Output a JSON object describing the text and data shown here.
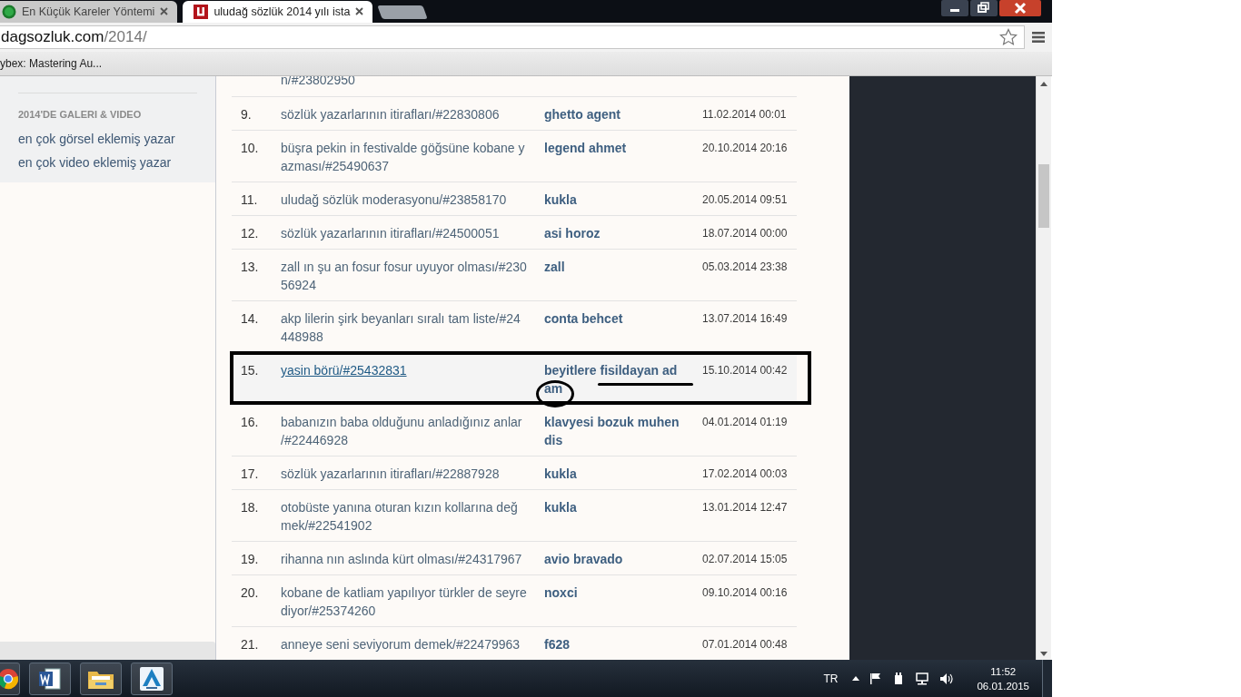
{
  "browser": {
    "tabs": [
      {
        "title": "En Küçük Kareler Yöntemi",
        "selected": false
      },
      {
        "title": "uludağ sözlük 2014 yılı ista",
        "selected": true
      }
    ],
    "address": {
      "host": "dagsozluk.com",
      "path": "/2014/"
    },
    "bookmarks": [
      "ybex: Mastering Au..."
    ]
  },
  "sidebar": {
    "heading": "2014'DE GALERI & VIDEO",
    "links": [
      "en çok görsel eklemiş yazar",
      "en çok video eklemiş yazar"
    ]
  },
  "table": {
    "rows": [
      {
        "kind": "partial",
        "title": "n/#23802950"
      },
      {
        "kind": "entry",
        "number": "9.",
        "title": "sözlük yazarlarının itirafları/#22830806",
        "author": "ghetto agent",
        "date": "11.02.2014 00:01",
        "selected": false
      },
      {
        "kind": "entry",
        "number": "10.",
        "title": "büşra pekin in festivalde göğsüne kobane yazması/#25490637",
        "author": "legend ahmet",
        "date": "20.10.2014 20:16",
        "selected": false
      },
      {
        "kind": "entry",
        "number": "11.",
        "title": "uludağ sözlük moderasyonu/#23858170",
        "author": "kukla",
        "date": "20.05.2014 09:51",
        "selected": false
      },
      {
        "kind": "entry",
        "number": "12.",
        "title": "sözlük yazarlarının itirafları/#24500051",
        "author": "asi horoz",
        "date": "18.07.2014 00:00",
        "selected": false
      },
      {
        "kind": "entry",
        "number": "13.",
        "title": "zall ın şu an fosur fosur uyuyor olması/#23056924",
        "author": "zall",
        "date": "05.03.2014 23:38",
        "selected": false
      },
      {
        "kind": "entry",
        "number": "14.",
        "title": "akp lilerin şirk beyanları sıralı tam liste/#24448988",
        "author": "conta behcet",
        "date": "13.07.2014 16:49",
        "selected": false
      },
      {
        "kind": "entry",
        "number": "15.",
        "title": "yasin börü/#25432831",
        "author": "beyitlere fisildayan adam",
        "date": "15.10.2014 00:42",
        "selected": true,
        "annotations": [
          {
            "kind": "frame"
          },
          {
            "kind": "circle"
          },
          {
            "kind": "underline"
          }
        ]
      },
      {
        "kind": "entry",
        "number": "16.",
        "title": "babanızın baba olduğunu anladığınız anlar /#22446928",
        "author": "klavyesi bozuk muhendis",
        "date": "04.01.2014 01:19",
        "selected": false
      },
      {
        "kind": "entry",
        "number": "17.",
        "title": "sözlük yazarlarının itirafları/#22887928",
        "author": "kukla",
        "date": "17.02.2014 00:03",
        "selected": false
      },
      {
        "kind": "entry",
        "number": "18.",
        "title": "otobüste yanına oturan kızın kollarına değmek/#22541902",
        "author": "kukla",
        "date": "13.01.2014 12:47",
        "selected": false
      },
      {
        "kind": "entry",
        "number": "19.",
        "title": "rihanna nın aslında kürt olması/#24317967",
        "author": "avio bravado",
        "date": "02.07.2014 15:05",
        "selected": false
      },
      {
        "kind": "entry",
        "number": "20.",
        "title": "kobane de katliam yapılıyor türkler de seyrediyor/#25374260",
        "author": "noxci",
        "date": "09.10.2014 00:16",
        "selected": false
      },
      {
        "kind": "entry",
        "number": "21.",
        "title": "anneye seni seviyorum demek/#22479963",
        "author": "f628",
        "date": "07.01.2014 00:48",
        "selected": false
      }
    ]
  },
  "taskbar": {
    "language": "TR",
    "time": "11:52",
    "date": "06.01.2015"
  }
}
